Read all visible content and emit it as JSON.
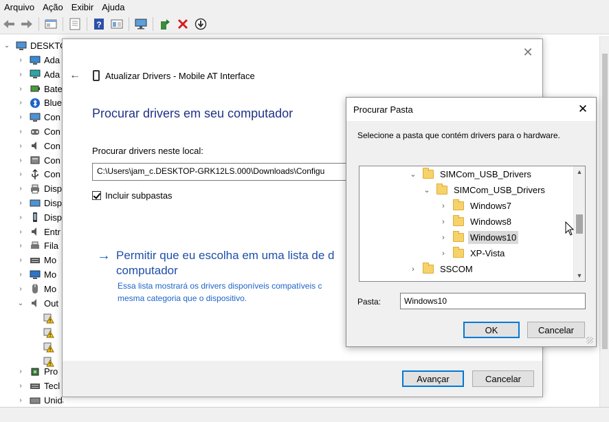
{
  "device_manager": {
    "menu": [
      "Arquivo",
      "Ação",
      "Exibir",
      "Ajuda"
    ],
    "toolbar_icons": [
      "back-arrow-icon",
      "forward-arrow-icon",
      "properties-icon",
      "view-icon",
      "help-icon",
      "view-details-icon",
      "monitor-scan-icon",
      "update-driver-icon",
      "remove-device-icon",
      "disable-device-icon"
    ],
    "tree": {
      "root": "DESKTO",
      "items": [
        {
          "label": "Ada",
          "icon": "display-adapter-icon",
          "chev": "›"
        },
        {
          "label": "Ada",
          "icon": "network-adapter-icon",
          "chev": "›"
        },
        {
          "label": "Bate",
          "icon": "battery-icon",
          "chev": "›"
        },
        {
          "label": "Blue",
          "icon": "bluetooth-icon",
          "chev": "›"
        },
        {
          "label": "Con",
          "icon": "computer-icon",
          "chev": "›"
        },
        {
          "label": "Con",
          "icon": "controller-icon",
          "chev": "›"
        },
        {
          "label": "Con",
          "icon": "sound-icon",
          "chev": "›"
        },
        {
          "label": "Con",
          "icon": "storage-icon",
          "chev": "›"
        },
        {
          "label": "Con",
          "icon": "usb-icon",
          "chev": "›"
        },
        {
          "label": "Disp",
          "icon": "printer-icon",
          "chev": "›"
        },
        {
          "label": "Disp",
          "icon": "device-icon",
          "chev": "›"
        },
        {
          "label": "Disp",
          "icon": "phone-icon",
          "chev": "›"
        },
        {
          "label": "Entr",
          "icon": "audio-input-icon",
          "chev": "›"
        },
        {
          "label": "Fila",
          "icon": "print-queue-icon",
          "chev": "›"
        },
        {
          "label": "Mo",
          "icon": "keyboard-icon",
          "chev": "›"
        },
        {
          "label": "Mo",
          "icon": "monitor-icon",
          "chev": "›"
        },
        {
          "label": "Mo",
          "icon": "mouse-icon",
          "chev": "›"
        },
        {
          "label": "Out",
          "icon": "other-devices-icon",
          "chev": "⌄"
        }
      ],
      "bottom_items": [
        {
          "label": "Pro",
          "icon": "processor-icon",
          "chev": "›"
        },
        {
          "label": "Tecl",
          "icon": "keyboard-icon",
          "chev": "›"
        },
        {
          "label": "Unidades de disco",
          "icon": "disk-drive-icon",
          "chev": "›"
        }
      ]
    }
  },
  "wizard": {
    "close": "✕",
    "back": "←",
    "title": "Atualizar Drivers - Mobile AT Interface",
    "heading": "Procurar drivers em seu computador",
    "location_label": "Procurar drivers neste local:",
    "path_value": "C:\\Users\\jam_c.DESKTOP-GRK12LS.000\\Downloads\\Configu",
    "include_subfolders": "Incluir subpastas",
    "include_subfolders_checked": true,
    "option_arrow": "→",
    "option_title": "Permitir que eu escolha em uma lista de d computador",
    "option_desc": "Essa lista mostrará os drivers disponíveis compatíveis c mesma categoria que o dispositivo.",
    "next_button": "Avançar",
    "cancel_button": "Cancelar"
  },
  "browse": {
    "title": "Procurar Pasta",
    "close": "✕",
    "prompt": "Selecione a pasta que contém drivers para o hardware.",
    "folders": [
      {
        "label": "SIMCom_USB_Drivers",
        "chev": "⌄"
      },
      {
        "label": "SIMCom_USB_Drivers",
        "chev": "⌄"
      },
      {
        "label": "Windows7",
        "chev": "›"
      },
      {
        "label": "Windows8",
        "chev": "›"
      },
      {
        "label": "Windows10",
        "chev": "›"
      },
      {
        "label": "XP-Vista",
        "chev": "›"
      },
      {
        "label": "SSCOM",
        "chev": "›"
      }
    ],
    "selected_folder": "Windows10",
    "folder_label": "Pasta:",
    "folder_value": "Windows10",
    "ok_button": "OK",
    "cancel_button": "Cancelar",
    "scroll_up": "▲",
    "scroll_down": "▼"
  },
  "colors": {
    "heading_blue": "#1e3287",
    "link_blue": "#1e64c8",
    "default_button_border": "#0078d7",
    "folder_yellow": "#f7d26a",
    "dialog_bg": "#f0f0f0"
  }
}
